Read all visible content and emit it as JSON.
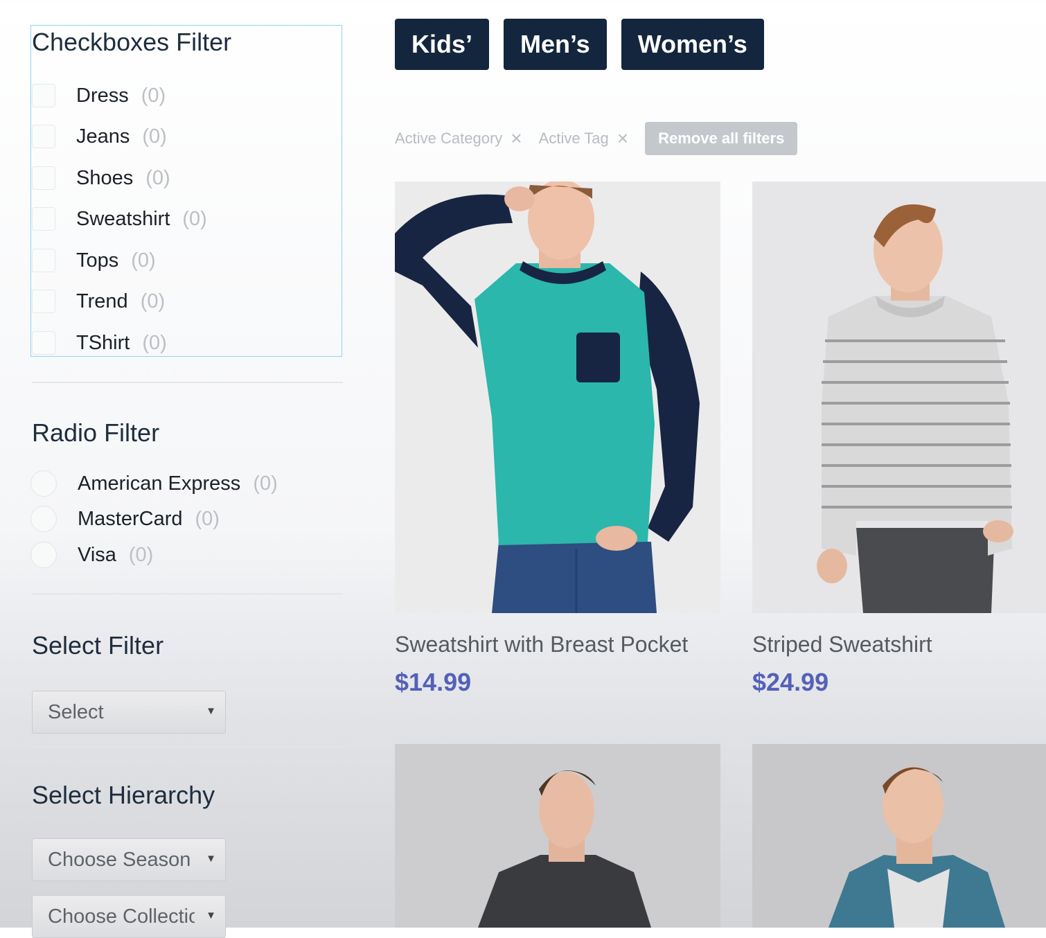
{
  "checkbox_filter": {
    "title": "Checkboxes Filter",
    "options": [
      {
        "label": "Dress",
        "count": "(0)"
      },
      {
        "label": "Jeans",
        "count": "(0)"
      },
      {
        "label": "Shoes",
        "count": "(0)"
      },
      {
        "label": "Sweatshirt",
        "count": "(0)"
      },
      {
        "label": "Tops",
        "count": "(0)"
      },
      {
        "label": "Trend",
        "count": "(0)"
      },
      {
        "label": "TShirt",
        "count": "(0)"
      }
    ]
  },
  "radio_filter": {
    "title": "Radio Filter",
    "options": [
      {
        "label": "American Express",
        "count": "(0)"
      },
      {
        "label": "MasterCard",
        "count": "(0)"
      },
      {
        "label": "Visa",
        "count": "(0)"
      }
    ]
  },
  "select_filter": {
    "title": "Select Filter",
    "value": "Select"
  },
  "select_hierarchy": {
    "title": "Select Hierarchy",
    "season_value": "Choose Season",
    "collection_value": "Choose Collection"
  },
  "tabs": [
    "Kids’",
    "Men’s",
    "Women’s"
  ],
  "active_filters": {
    "category_chip": "Active Category",
    "tag_chip": "Active Tag",
    "remove_close": "×",
    "remove_all": "Remove all filters"
  },
  "products": [
    {
      "name": "Sweatshirt with Breast Pocket",
      "price": "$14.99",
      "image": "man in teal and navy raglan sweatshirt"
    },
    {
      "name": "Striped Sweatshirt",
      "price": "$24.99",
      "image": "man in grey striped sweater"
    },
    {
      "name": "",
      "price": "",
      "image": "man in dark knit hoodie"
    },
    {
      "name": "",
      "price": "",
      "image": "man in blue jacket"
    }
  ],
  "colors": {
    "tab_bg": "#14263e",
    "price": "#5461b8",
    "focus_border": "#8fd6ea",
    "chip_text": "#b7bcc2"
  }
}
